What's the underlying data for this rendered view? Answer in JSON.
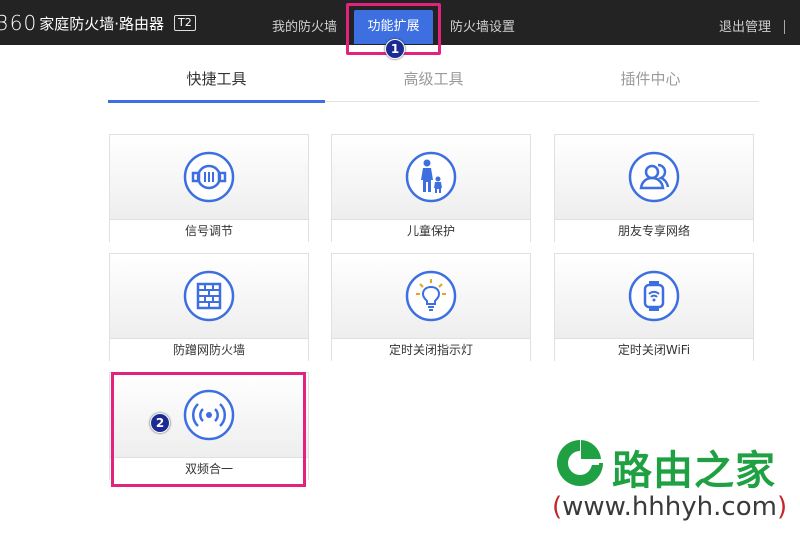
{
  "header": {
    "brand_number": "360",
    "brand_text": "家庭防火墙·路由器",
    "brand_badge": "T2",
    "nav": [
      "我的防火墙",
      "功能扩展",
      "防火墙设置"
    ],
    "logout": "退出管理"
  },
  "markers": [
    "1",
    "2"
  ],
  "subtabs": [
    "快捷工具",
    "高级工具",
    "插件中心"
  ],
  "tools": [
    {
      "label": "信号调节",
      "icon": "signal-adjust-icon"
    },
    {
      "label": "儿童保护",
      "icon": "child-protection-icon"
    },
    {
      "label": "朋友专享网络",
      "icon": "friends-network-icon"
    },
    {
      "label": "防蹭网防火墙",
      "icon": "firewall-icon"
    },
    {
      "label": "定时关闭指示灯",
      "icon": "light-bulb-icon"
    },
    {
      "label": "定时关闭WiFi",
      "icon": "wifi-watch-icon"
    },
    {
      "label": "双频合一",
      "icon": "dual-band-icon"
    }
  ],
  "watermark": {
    "title": "路由之家",
    "url_open": "(",
    "url": "www.hhhyh.com",
    "url_close": ")"
  },
  "colors": {
    "accent": "#3d6fe0",
    "highlight": "#e2237e",
    "watermark": "#1fa042"
  }
}
